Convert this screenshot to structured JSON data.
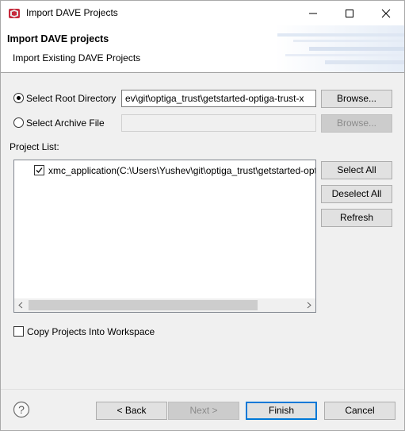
{
  "window": {
    "title": "Import DAVE Projects",
    "icon": "dave-app-icon",
    "controls": [
      "minimize-icon",
      "maximize-icon",
      "close-icon"
    ]
  },
  "banner": {
    "title": "Import DAVE projects",
    "description": "Import Existing DAVE Projects"
  },
  "source": {
    "root_label": "Select Root Directory",
    "root_value": "ev\\git\\optiga_trust\\getstarted-optiga-trust-x",
    "root_selected": true,
    "archive_label": "Select Archive File",
    "archive_value": "",
    "archive_selected": false,
    "browse_label": "Browse...",
    "browse_archive_label": "Browse..."
  },
  "projects": {
    "label": "Project List:",
    "items": [
      {
        "name": "xmc_application(C:\\Users\\Yushev\\git\\optiga_trust\\getstarted-optiga-trust-x",
        "checked": true
      }
    ],
    "select_all": "Select All",
    "deselect_all": "Deselect All",
    "refresh": "Refresh"
  },
  "options": {
    "copy_label": "Copy Projects Into Workspace",
    "copy_checked": false
  },
  "footer": {
    "help_icon": "help-icon",
    "back": "< Back",
    "next": "Next >",
    "finish": "Finish",
    "cancel": "Cancel"
  },
  "colors": {
    "accent": "#0078d7",
    "dialog_bg": "#f0f0f0",
    "disabled_text": "#8b8b8b"
  }
}
